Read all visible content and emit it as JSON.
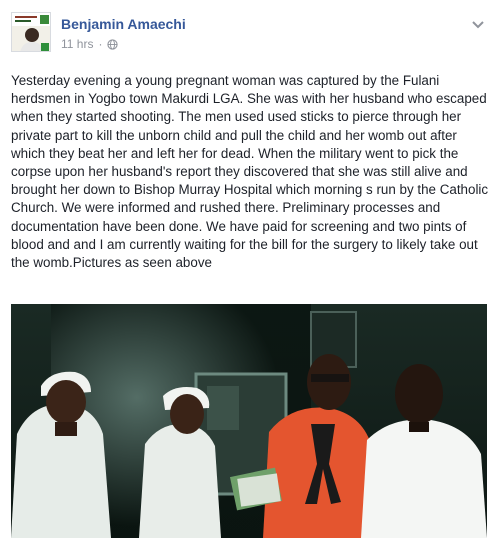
{
  "post": {
    "author": "Benjamin Amaechi",
    "time": "11 hrs",
    "separator": "·",
    "privacy_icon": "globe-icon",
    "options_icon": "chevron-down-icon",
    "lead": ".",
    "body": "Yesterday evening a young pregnant woman was captured by the Fulani herdsmen in Yogbo town Makurdi LGA. She was with her husband who escaped when they started shooting. The men used used sticks to pierce through her private part to kill the unborn child and pull the child and her womb out after which they beat her and left her for dead. When the military went to pick the corpse upon her husband's report they discovered that she was still alive and brought her down to Bishop Murray Hospital which morning s run by the Catholic Church. We were informed and rushed there. Preliminary processes and documentation have been done. We have paid for screening and two pints of blood and and I am currently waiting for the bill for the surgery to likely take out the womb.Pictures as seen above"
  },
  "colors": {
    "link": "#365899",
    "meta": "#90949c",
    "text": "#1d2129"
  }
}
